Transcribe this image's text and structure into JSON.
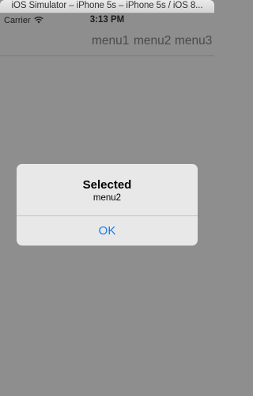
{
  "window": {
    "title": "iOS Simulator – iPhone 5s – iPhone 5s / iOS 8..."
  },
  "status_bar": {
    "carrier": "Carrier",
    "wifi_icon": "wifi-icon",
    "time": "3:13 PM"
  },
  "navbar": {
    "menu_items": [
      {
        "label": "menu1"
      },
      {
        "label": "menu2"
      },
      {
        "label": "menu3"
      }
    ]
  },
  "alert": {
    "title": "Selected",
    "message": "menu2",
    "button_label": "OK",
    "button_color": "#1a7ae8"
  },
  "colors": {
    "dimmed_background": "#8e8e8e",
    "alert_background": "#e8e8e8"
  }
}
